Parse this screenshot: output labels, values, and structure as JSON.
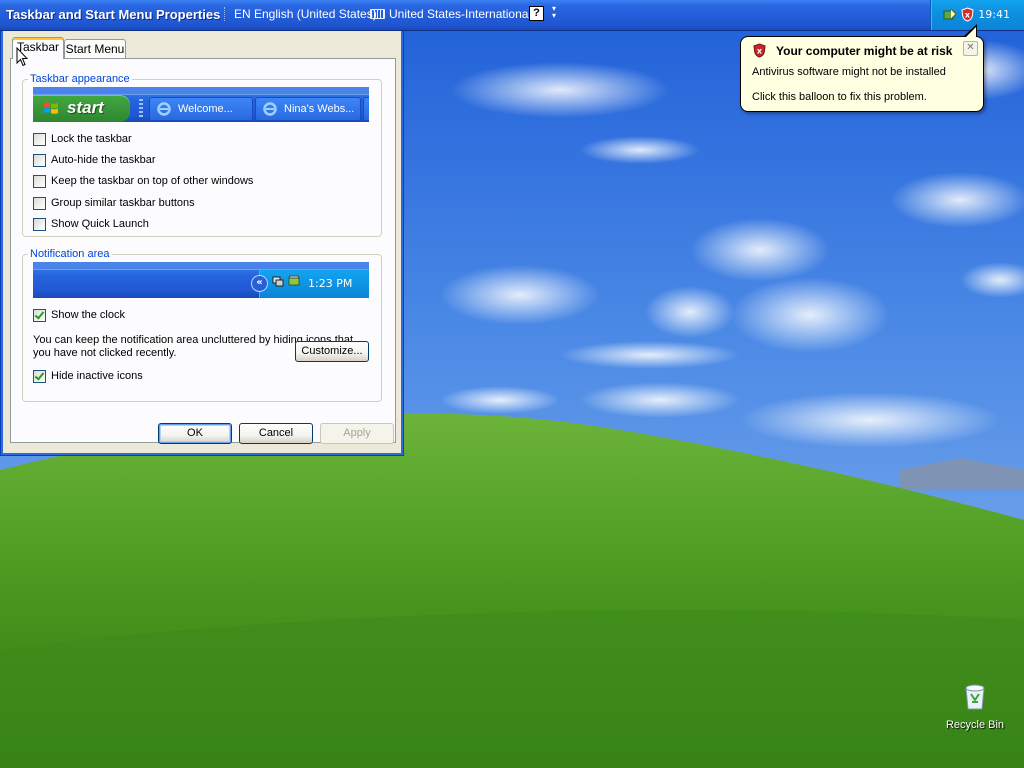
{
  "taskbar": {
    "window_title": "Taskbar and Start Menu Properties",
    "language": "EN English (United States)",
    "keyboard": "United States-International",
    "clock": "19:41"
  },
  "balloon": {
    "title": "Your computer might be at risk",
    "line1": "Antivirus software might not be installed",
    "line2": "Click this balloon to fix this problem."
  },
  "dialog": {
    "tabs": [
      "Taskbar",
      "Start Menu"
    ],
    "appearance": {
      "legend": "Taskbar appearance",
      "start_label": "start",
      "preview_buttons": [
        "Welcome...",
        "Nina's Webs..."
      ],
      "options": [
        {
          "label": "Lock the taskbar",
          "checked": false
        },
        {
          "label": "Auto-hide the taskbar",
          "checked": false
        },
        {
          "label": "Keep the taskbar on top of other windows",
          "checked": false
        },
        {
          "label": "Group similar taskbar buttons",
          "checked": false
        },
        {
          "label": "Show Quick Launch",
          "checked": false
        }
      ]
    },
    "notification": {
      "legend": "Notification area",
      "preview_time": "1:23 PM",
      "show_clock": {
        "label": "Show the clock",
        "checked": true
      },
      "description": "You can keep the notification area uncluttered by hiding icons that you have not clicked recently.",
      "hide_inactive": {
        "label": "Hide inactive icons",
        "checked": true
      },
      "customize_label": "Customize..."
    },
    "buttons": {
      "ok": "OK",
      "cancel": "Cancel",
      "apply": "Apply"
    }
  },
  "desktop": {
    "recycle_bin_label": "Recycle Bin"
  },
  "colors": {
    "taskbar_blue": "#245edb",
    "tray_blue": "#0e90e0",
    "dialog_face": "#ece9d8",
    "legend_blue": "#0046d5",
    "balloon_bg": "#ffffe1"
  }
}
